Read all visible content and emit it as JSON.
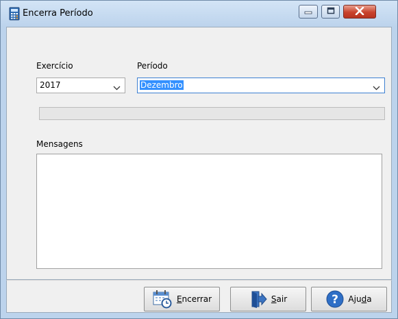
{
  "window": {
    "title": "Encerra Período"
  },
  "form": {
    "exercicio_label": "Exercício",
    "exercicio_value": "2017",
    "periodo_label": "Período",
    "periodo_value": "Dezembro",
    "progress": 0,
    "mensagens_label": "Mensagens"
  },
  "buttons": {
    "encerrar": {
      "mnemonic": "E",
      "rest": "ncerrar"
    },
    "sair": {
      "mnemonic": "S",
      "rest": "air"
    },
    "ajuda": {
      "pre": "Aju",
      "mnemonic": "d",
      "rest": "a"
    }
  },
  "icons": {
    "app": "calculator-icon",
    "encerrar": "calendar-clock-icon",
    "sair": "exit-door-icon",
    "ajuda": "help-icon"
  },
  "colors": {
    "titlebar": "#bcd3ec",
    "selection": "#3390ff",
    "close_button": "#c8432d"
  }
}
